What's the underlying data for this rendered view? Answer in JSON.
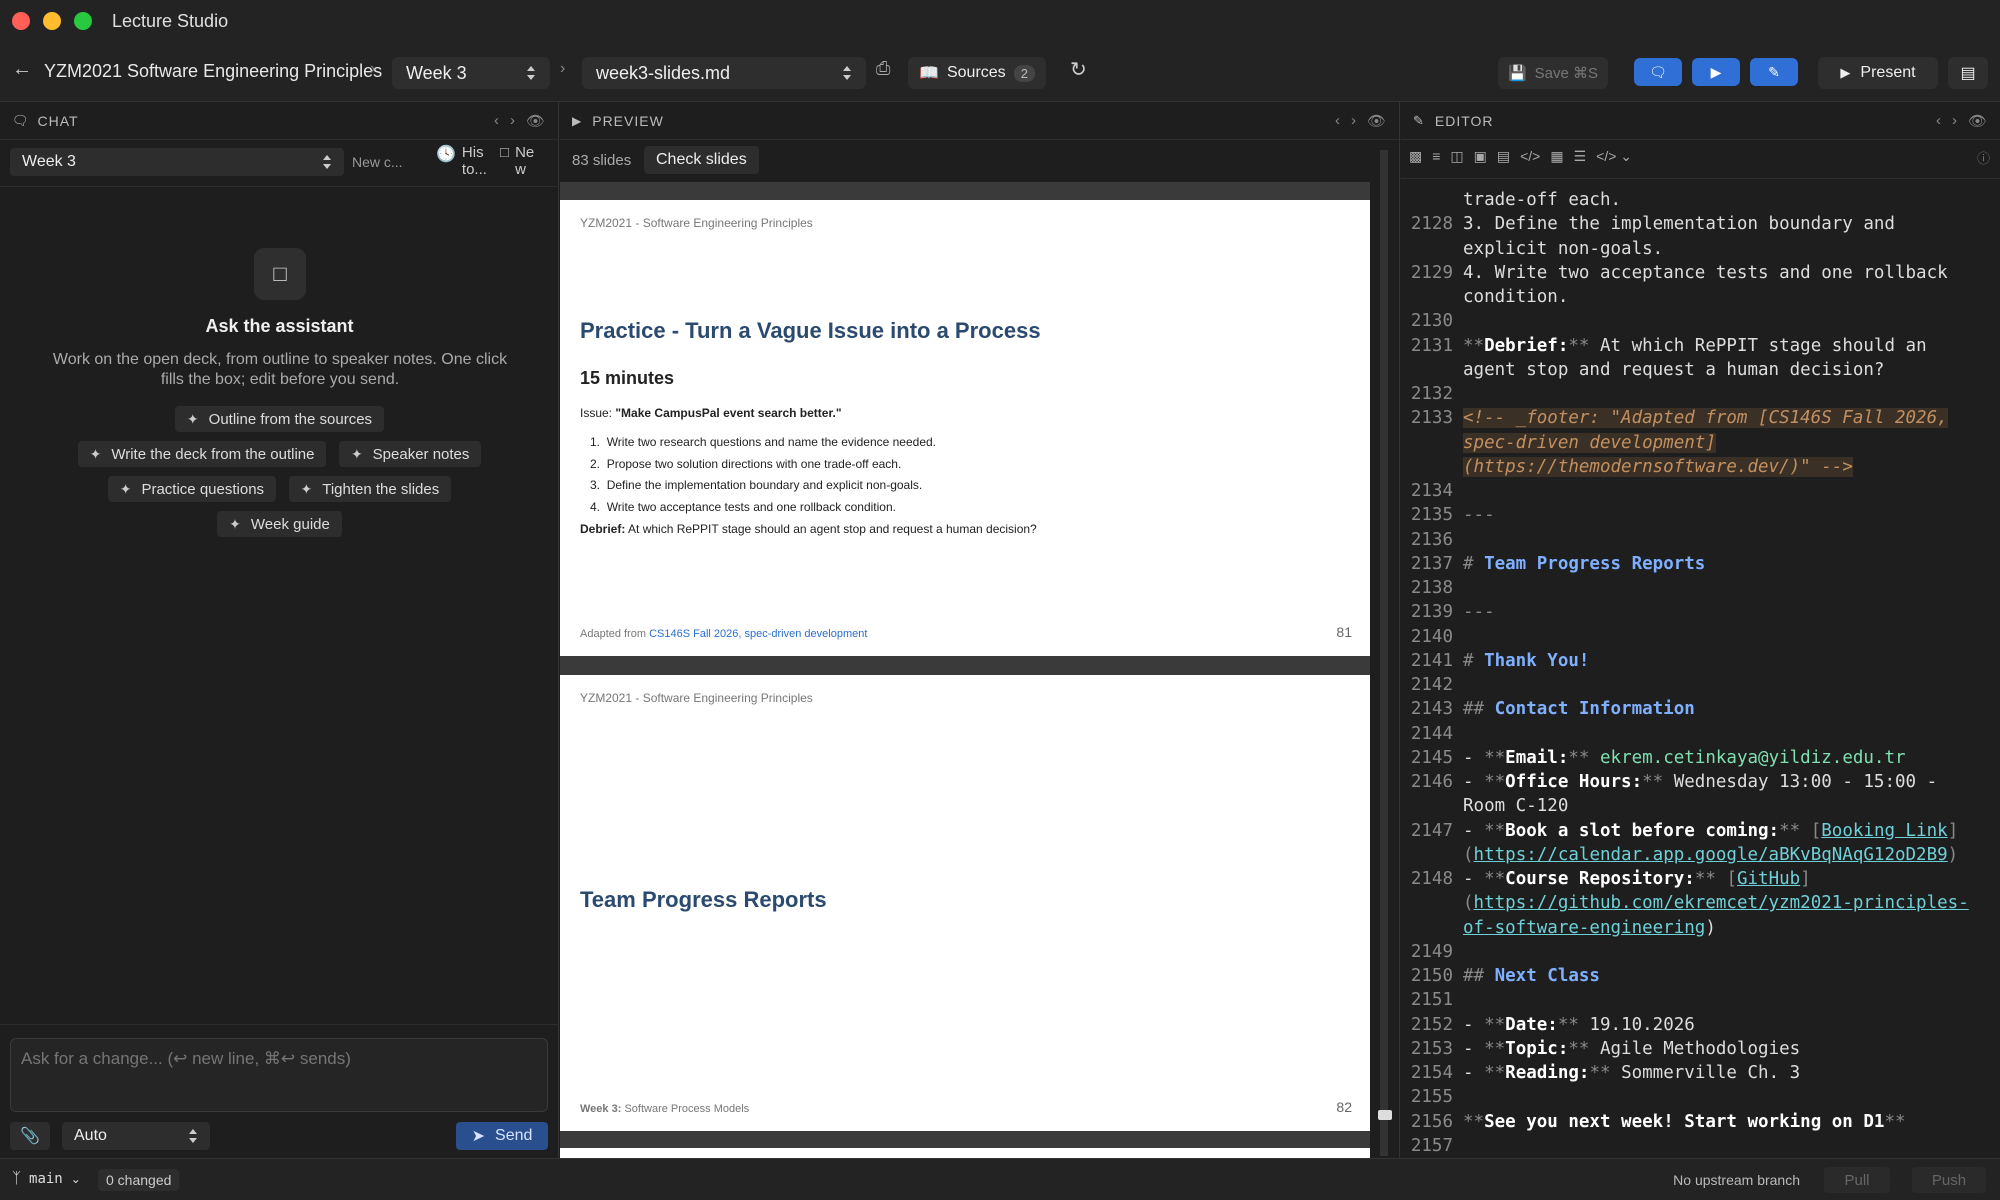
{
  "app": {
    "title": "Lecture Studio"
  },
  "toolbar": {
    "course": "YZM2021 Software Engineering Principles",
    "week": "Week 3",
    "file": "week3-slides.md",
    "sources_label": "Sources",
    "sources_count": "2",
    "save_label": "Save ⌘S",
    "present_label": "Present"
  },
  "chat": {
    "header": "CHAT",
    "week_select": "Week 3",
    "new_chat": "New c...",
    "history": "His to...",
    "new_window": "Ne w",
    "empty_title": "Ask the assistant",
    "empty_desc": "Work on the open deck, from outline to speaker notes. One click fills the box; edit before you send.",
    "suggestions": [
      "Outline from the sources",
      "Write the deck from the outline",
      "Speaker notes",
      "Practice questions",
      "Tighten the slides",
      "Week guide"
    ],
    "input_placeholder": "Ask for a change... (↩ new line, ⌘↩ sends)",
    "mode": "Auto",
    "send_label": "Send"
  },
  "preview": {
    "header": "PREVIEW",
    "slide_count": "83 slides",
    "check_label": "Check slides",
    "slides": [
      {
        "header": "YZM2021 - Software Engineering Principles",
        "title": "Practice - Turn a Vague Issue into a Process",
        "subtitle": "15 minutes",
        "issue_label": "Issue:",
        "issue_text": "\"Make CampusPal event search better.\"",
        "items": [
          "Write two research questions and name the evidence needed.",
          "Propose two solution directions with one trade-off each.",
          "Define the implementation boundary and explicit non-goals.",
          "Write two acceptance tests and one rollback condition."
        ],
        "debrief_label": "Debrief:",
        "debrief_text": "At which RePPIT stage should an agent stop and request a human decision?",
        "footer_prefix": "Adapted from",
        "footer_link": "CS146S Fall 2026, spec-driven development",
        "number": "81"
      },
      {
        "header": "YZM2021 - Software Engineering Principles",
        "title": "Team Progress Reports",
        "footer_bold": "Week 3:",
        "footer_text": "Software Process Models",
        "number": "82"
      }
    ]
  },
  "editor": {
    "header": "EDITOR",
    "lines": [
      {
        "n": "",
        "t": "trade-off each."
      },
      {
        "n": "2128",
        "t": "3. Define the implementation boundary and"
      },
      {
        "n": "",
        "t": "explicit non-goals."
      },
      {
        "n": "2129",
        "t": "4. Write two acceptance tests and one rollback"
      },
      {
        "n": "",
        "t": "condition."
      },
      {
        "n": "2130",
        "t": ""
      },
      {
        "n": "2131",
        "t": "**Debrief:** At which RePPIT stage should an"
      },
      {
        "n": "",
        "t": "agent stop and request a human decision?"
      },
      {
        "n": "2132",
        "t": ""
      },
      {
        "n": "2133",
        "t": "<!-- _footer: \"Adapted from [CS146S Fall 2026,"
      },
      {
        "n": "",
        "t": "spec-driven development]"
      },
      {
        "n": "",
        "t": "(https://themodernsoftware.dev/)\" -->"
      },
      {
        "n": "2134",
        "t": ""
      },
      {
        "n": "2135",
        "t": "---"
      },
      {
        "n": "2136",
        "t": ""
      },
      {
        "n": "2137",
        "t": "# Team Progress Reports"
      },
      {
        "n": "2138",
        "t": ""
      },
      {
        "n": "2139",
        "t": "---"
      },
      {
        "n": "2140",
        "t": ""
      },
      {
        "n": "2141",
        "t": "# Thank You!"
      },
      {
        "n": "2142",
        "t": ""
      },
      {
        "n": "2143",
        "t": "## Contact Information"
      },
      {
        "n": "2144",
        "t": ""
      },
      {
        "n": "2145",
        "t": "- **Email:** ekrem.cetinkaya@yildiz.edu.tr"
      },
      {
        "n": "2146",
        "t": "- **Office Hours:** Wednesday 13:00 - 15:00 -"
      },
      {
        "n": "",
        "t": "Room C-120"
      },
      {
        "n": "2147",
        "t": "- **Book a slot before coming:** [Booking Link]"
      },
      {
        "n": "",
        "t": "(https://calendar.app.google/aBKvBqNAqG12oD2B9)"
      },
      {
        "n": "2148",
        "t": "- **Course Repository:** [GitHub]"
      },
      {
        "n": "",
        "t": "(https://github.com/ekremcet/yzm2021-principles-"
      },
      {
        "n": "",
        "t": "of-software-engineering)"
      },
      {
        "n": "2149",
        "t": ""
      },
      {
        "n": "2150",
        "t": "## Next Class"
      },
      {
        "n": "2151",
        "t": ""
      },
      {
        "n": "2152",
        "t": "- **Date:** 19.10.2026"
      },
      {
        "n": "2153",
        "t": "- **Topic:** Agile Methodologies"
      },
      {
        "n": "2154",
        "t": "- **Reading:** Sommerville Ch. 3"
      },
      {
        "n": "2155",
        "t": ""
      },
      {
        "n": "2156",
        "t": "**See you next week! Start working on D1**"
      },
      {
        "n": "2157",
        "t": ""
      }
    ]
  },
  "status": {
    "branch": "main",
    "changed": "0 changed",
    "upstream": "No upstream branch",
    "pull": "Pull",
    "push": "Push"
  }
}
